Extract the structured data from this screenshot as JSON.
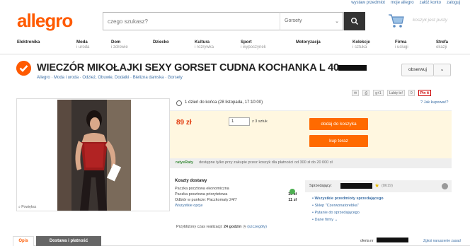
{
  "toplinks": [
    "wystaw przedmiot",
    "moje allegro",
    "załóż konto",
    "zaloguj"
  ],
  "logo": "allegro",
  "search": {
    "placeholder": "czego szukasz?",
    "category": "Gorsety"
  },
  "cart": {
    "label": "koszyk jest pusty"
  },
  "nav": [
    {
      "t": "Elektronika",
      "s": ""
    },
    {
      "t": "Moda",
      "s": "i uroda"
    },
    {
      "t": "Dom",
      "s": "i zdrowie"
    },
    {
      "t": "Dziecko",
      "s": ""
    },
    {
      "t": "Kultura",
      "s": "i rozrywka"
    },
    {
      "t": "Sport",
      "s": "i wypoczynek"
    },
    {
      "t": "Motoryzacja",
      "s": ""
    },
    {
      "t": "Kolekcje",
      "s": "i sztuka"
    },
    {
      "t": "Firma",
      "s": "i usługi"
    },
    {
      "t": "Strefa",
      "s": "okazji"
    }
  ],
  "item": {
    "title": "WIECZÓR MIKOŁAJKI SEXY GORSET CUDNA KOCHANKA L 40",
    "breadcrumb": "Allegro · Moda i uroda · Odzież, Obuwie, Dodatki · Bielizna damska · Gorsety",
    "observe": "obserwuj",
    "photo_enlarge": "Powiększ",
    "share": [
      "g+1",
      "Lubię to!",
      "0",
      "Pin it"
    ],
    "time_left": "1 dzień do końca (28 listopada, 17:10:00)",
    "how_to_buy": "Jak kupować?",
    "price": "89 zł",
    "quantity": "1",
    "quantity_of": "z 3 sztuk",
    "add_to_cart": "dodaj do koszyka",
    "buy_now": "kup teraz",
    "raty_logo": "ratyeRaty",
    "raty_text": "dostępne tylko przy zakupie przez koszyk dla płatności od 300 zł do 20 000 zł"
  },
  "shipping": {
    "title": "Koszty dostawy",
    "rows": [
      {
        "name": "Paczka pocztowa ekonomiczna",
        "price": ""
      },
      {
        "name": "Paczka pocztowa priorytetowa",
        "price": "10 zł"
      },
      {
        "name": "Odbiór w punkcie: Paczkomaty 24/7",
        "price": "11 zł"
      }
    ],
    "more": "Wszystkie opcje",
    "realization_prefix": "Przybliżony czas realizacji:",
    "realization_value": "24 godzin",
    "realization_link": "(szczegóły)"
  },
  "seller": {
    "label": "Sprzedający:",
    "score": "(8619)",
    "links": [
      "Wszystkie przedmioty sprzedającego",
      "Sklep \"Czerwonatorebka\"",
      "Pytanie do sprzedającego",
      "Dane firmy"
    ]
  },
  "tabs": [
    "Opis",
    "Dostawa i płatność"
  ],
  "footer": {
    "offer_no": "oferta nr",
    "report": "Zgłoś naruszenie zasad"
  }
}
